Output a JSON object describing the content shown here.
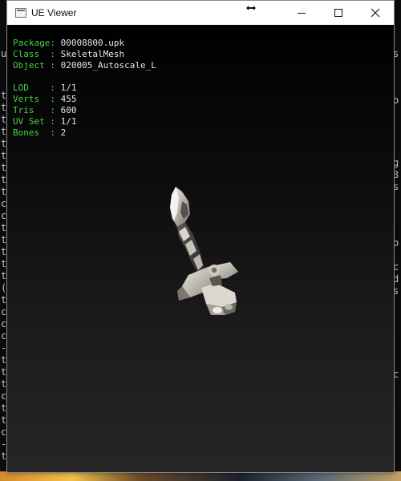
{
  "window": {
    "title": "UE Viewer",
    "resize_cursor_icon": "horizontal-resize-cursor",
    "controls": {
      "minimize_icon": "minimize-icon",
      "maximize_icon": "maximize-icon",
      "close_icon": "close-icon"
    }
  },
  "mesh_info": [
    {
      "key": "Package",
      "sep": ": ",
      "value": "00008800.upk"
    },
    {
      "key": "Class  ",
      "sep": ": ",
      "value": "SkeletalMesh"
    },
    {
      "key": "Object ",
      "sep": ": ",
      "value": "020005_Autoscale_L"
    }
  ],
  "lod_info": [
    {
      "key": "LOD    ",
      "sep": ": ",
      "value": "1/1"
    },
    {
      "key": "Verts  ",
      "sep": ": ",
      "value": "455"
    },
    {
      "key": "Tris   ",
      "sep": ": ",
      "value": "600"
    },
    {
      "key": "UV Set ",
      "sep": ": ",
      "value": "1/1"
    },
    {
      "key": "Bones  ",
      "sep": ": ",
      "value": "2"
    }
  ],
  "background_console": {
    "left_glyphs": [
      "u",
      "t",
      "t",
      "t",
      "t",
      "t",
      "t",
      "t",
      "t",
      "t",
      "c",
      "c",
      "t",
      "t",
      "t",
      "t",
      "t",
      "(",
      "t",
      "c",
      "c",
      "c",
      "-",
      "t",
      "t",
      "t",
      "c",
      "t",
      "t",
      "c",
      "-",
      "t",
      "t",
      "t",
      "c"
    ],
    "right_glyphs": [
      "s",
      "o",
      "g",
      "3",
      "s",
      "o",
      "c",
      "d",
      "s",
      "c"
    ]
  },
  "colors": {
    "label": "#47d147",
    "value": "#e6e6e6",
    "viewport_top": "#000000",
    "viewport_bottom": "#262626",
    "titlebar": "#ffffff"
  }
}
